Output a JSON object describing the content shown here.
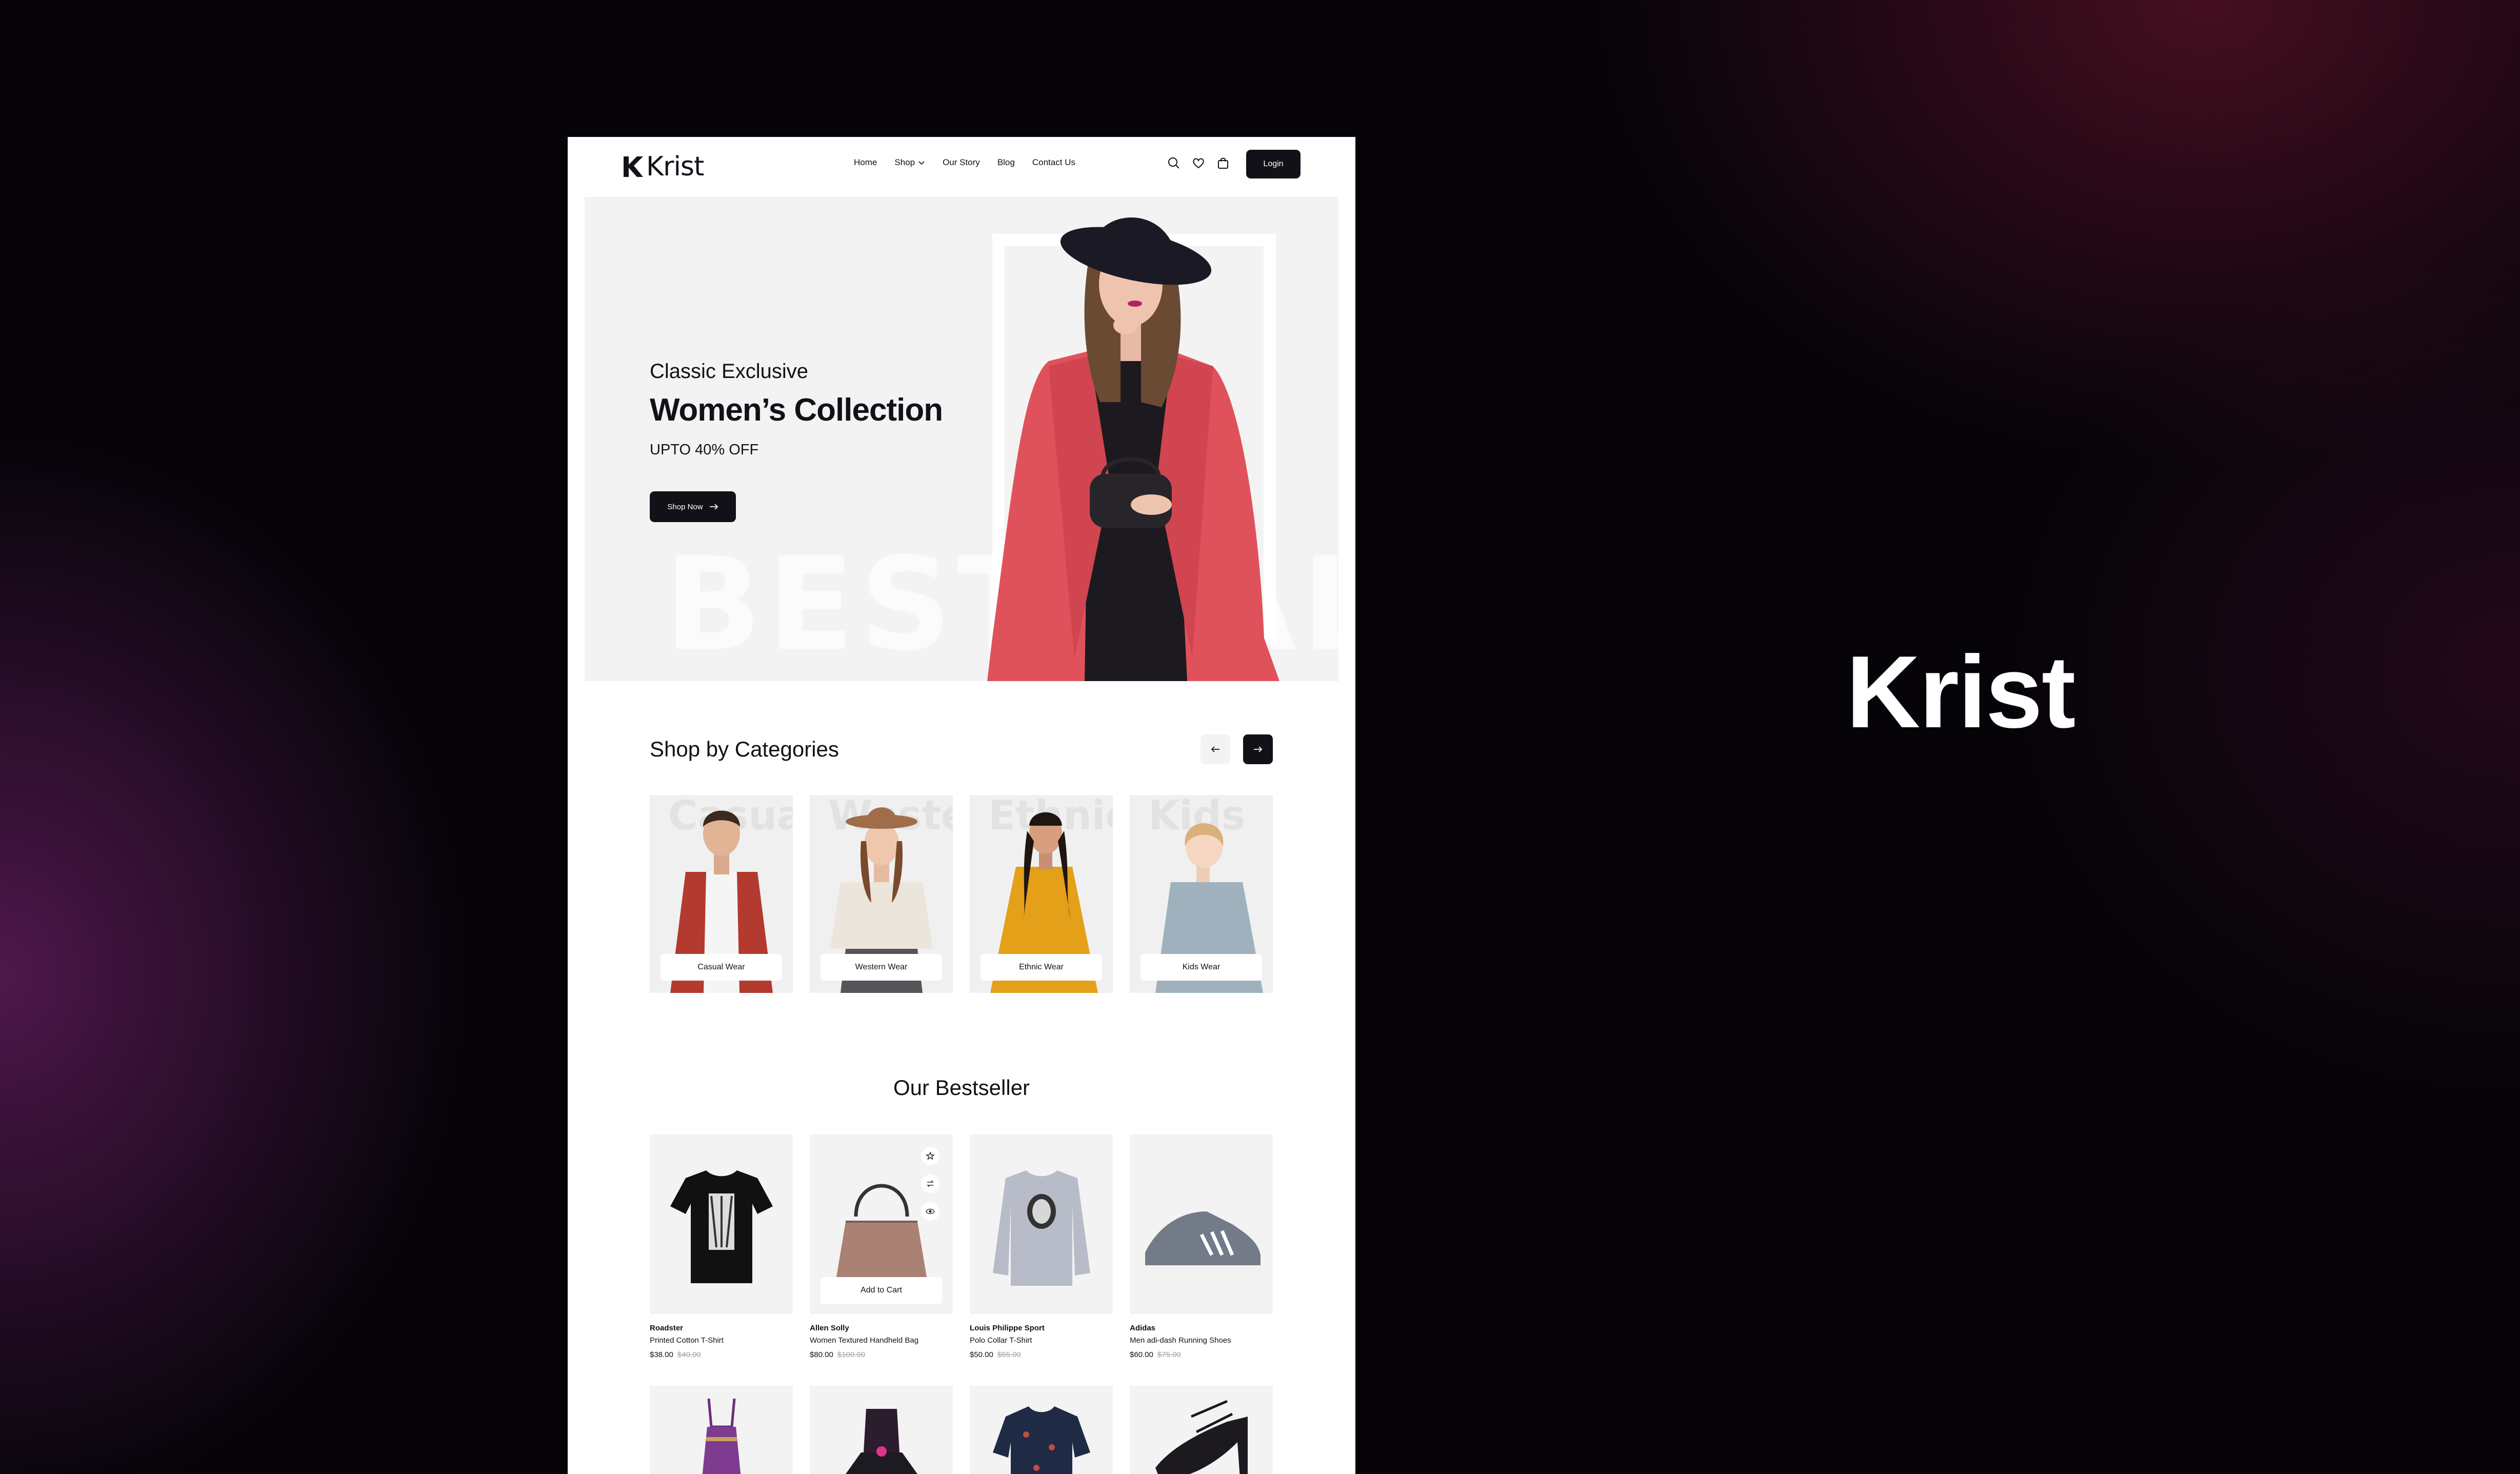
{
  "brand_title": "Krist",
  "header": {
    "logo_text": "Krist",
    "nav": [
      "Home",
      "Shop",
      "Our Story",
      "Blog",
      "Contact Us"
    ],
    "login_label": "Login",
    "icons": [
      "search-icon",
      "heart-icon",
      "bag-icon"
    ]
  },
  "hero": {
    "eyebrow": "Classic Exclusive",
    "title": "Women’s Collection",
    "offer": "UPTO 40% OFF",
    "cta_label": "Shop Now",
    "watermark": "BEST SALE"
  },
  "categories": {
    "title": "Shop by Categories",
    "items": [
      {
        "label": "Casual Wear",
        "watermark": "Casual"
      },
      {
        "label": "Western Wear",
        "watermark": "Western"
      },
      {
        "label": "Ethnic Wear",
        "watermark": "Ethnic"
      },
      {
        "label": "Kids Wear",
        "watermark": "Kids"
      }
    ]
  },
  "bestseller": {
    "title": "Our Bestseller",
    "add_to_cart": "Add to Cart",
    "products": [
      {
        "brand": "Roadster",
        "name": "Printed Cotton T-Shirt",
        "price": "$38.00",
        "old_price": "$40.00"
      },
      {
        "brand": "Allen Solly",
        "name": "Women Textured Handheld Bag",
        "price": "$80.00",
        "old_price": "$100.00"
      },
      {
        "brand": "Louis Philippe Sport",
        "name": "Polo Collar T-Shirt",
        "price": "$50.00",
        "old_price": "$55.00"
      },
      {
        "brand": "Adidas",
        "name": "Men adi-dash Running Shoes",
        "price": "$60.00",
        "old_price": "$75.00"
      }
    ]
  },
  "colors": {
    "dark": "#131118",
    "light_bg": "#f3f3f3",
    "coat": "#e0525b"
  }
}
